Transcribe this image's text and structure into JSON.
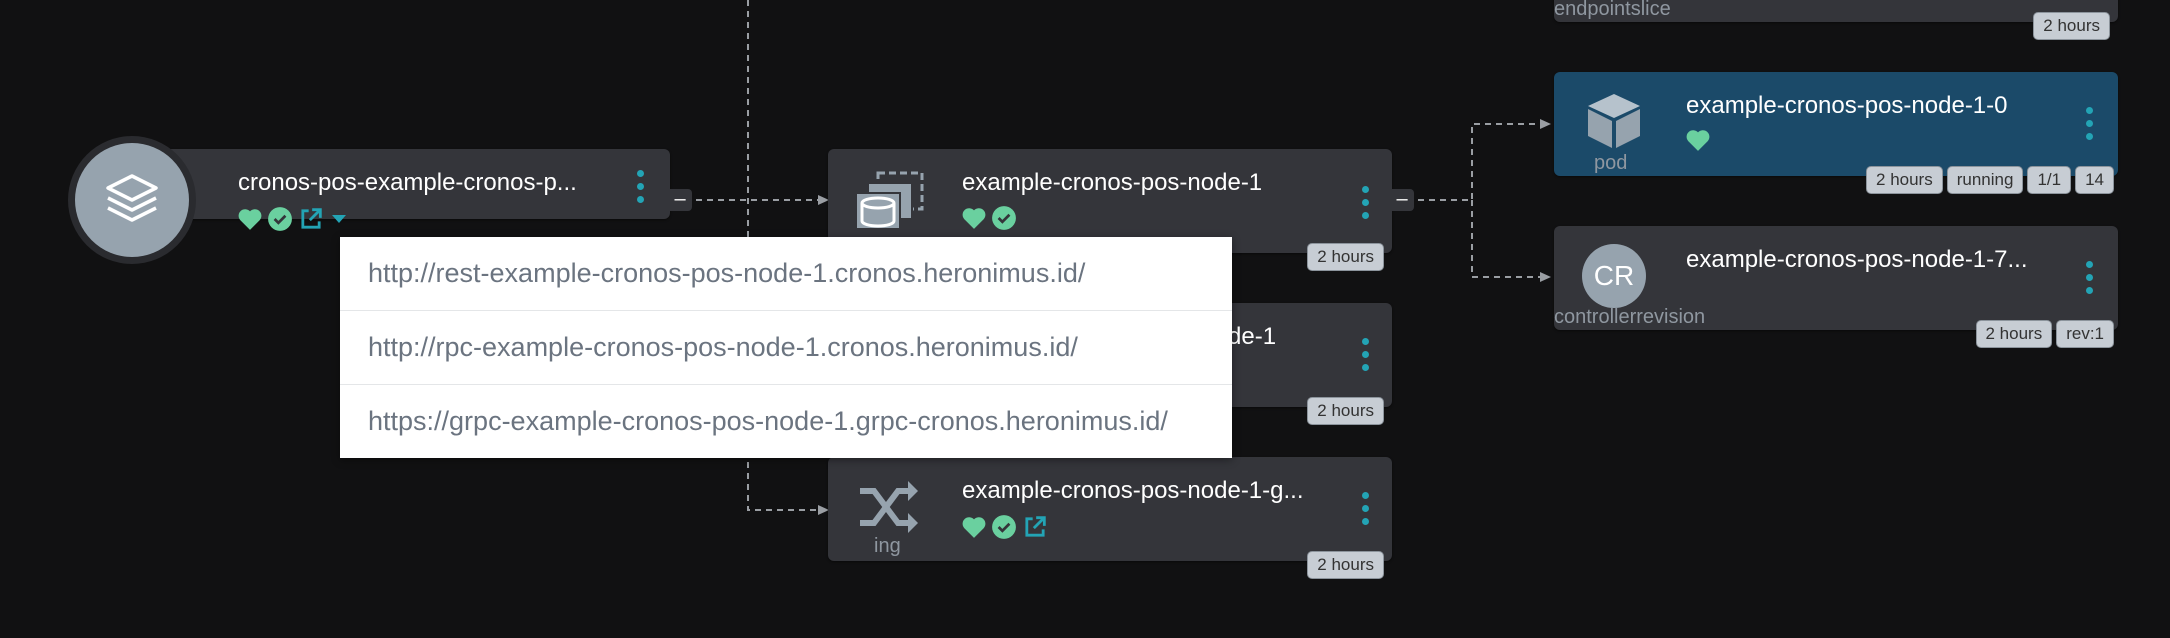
{
  "colors": {
    "background": "#111112",
    "node": "#34353a",
    "selected_node": "#1b4a69",
    "health_green": "#6ad09f",
    "teal": "#23a4b5",
    "icon_gray": "#96a3ae"
  },
  "app_node": {
    "title": "cronos-pos-example-cronos-p...",
    "icons": [
      "heart-icon",
      "check-circle-icon",
      "external-link-icon",
      "caret-down-icon"
    ],
    "collapse_symbol": "–"
  },
  "nodes": {
    "statefulset": {
      "title": "example-cronos-pos-node-1",
      "age": "2 hours",
      "collapse_symbol": "–"
    },
    "service": {
      "title_visible": "de-1",
      "age": "2 hours"
    },
    "ingress": {
      "title": "example-cronos-pos-node-1-g...",
      "kind": "ing",
      "age": "2 hours"
    },
    "endpointslice": {
      "kind": "endpointslice",
      "age": "2 hours"
    },
    "pod": {
      "title": "example-cronos-pos-node-1-0",
      "kind": "pod",
      "badges": [
        "2 hours",
        "running",
        "1/1",
        "14"
      ]
    },
    "controllerrevision": {
      "title": "example-cronos-pos-node-1-7...",
      "kind": "controllerrevision",
      "avatar": "CR",
      "badges": [
        "2 hours",
        "rev:1"
      ]
    }
  },
  "dropdown": {
    "items": [
      "http://rest-example-cronos-pos-node-1.cronos.heronimus.id/",
      "http://rpc-example-cronos-pos-node-1.cronos.heronimus.id/",
      "https://grpc-example-cronos-pos-node-1.grpc-cronos.heronimus.id/"
    ]
  }
}
